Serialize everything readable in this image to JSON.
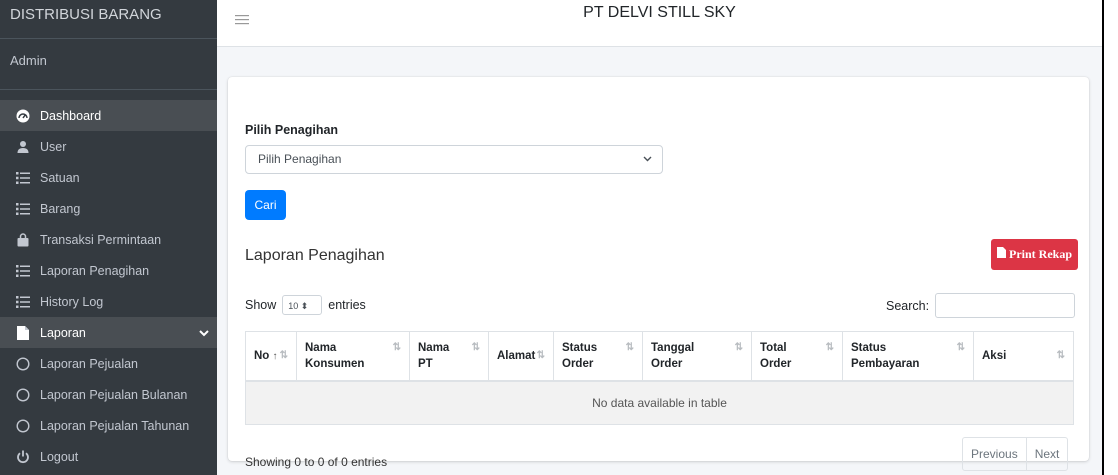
{
  "sidebar": {
    "brand": "DISTRIBUSI BARANG",
    "user": "Admin",
    "items": [
      {
        "label": "Dashboard",
        "icon": "dashboard-icon"
      },
      {
        "label": "User",
        "icon": "user-icon"
      },
      {
        "label": "Satuan",
        "icon": "list-icon"
      },
      {
        "label": "Barang",
        "icon": "list-icon"
      },
      {
        "label": "Transaksi Permintaan",
        "icon": "bag-icon"
      },
      {
        "label": "Laporan Penagihan",
        "icon": "list-icon"
      },
      {
        "label": "History Log",
        "icon": "list-icon"
      },
      {
        "label": "Laporan",
        "icon": "file-icon"
      },
      {
        "label": "Laporan Pejualan",
        "icon": "circle-icon"
      },
      {
        "label": "Laporan Pejualan Bulanan",
        "icon": "circle-icon"
      },
      {
        "label": "Laporan Pejualan Tahunan",
        "icon": "circle-icon"
      },
      {
        "label": "Logout",
        "icon": "power-icon"
      }
    ]
  },
  "topbar": {
    "title": "PT DELVI STILL SKY"
  },
  "form": {
    "label": "Pilih Penagihan",
    "select_value": "Pilih Penagihan",
    "button": "Cari"
  },
  "report": {
    "title": "Laporan Penagihan",
    "print_button": "Print Rekap",
    "show_label": "Show",
    "entries_value": "10",
    "entries_label": "entries",
    "search_label": "Search:"
  },
  "table": {
    "columns": [
      [
        "No"
      ],
      [
        "Nama",
        "Konsumen"
      ],
      [
        "Nama",
        "PT"
      ],
      [
        "Alamat"
      ],
      [
        "Status",
        "Order"
      ],
      [
        "Tanggal",
        "Order"
      ],
      [
        "Total",
        "Order"
      ],
      [
        "Status",
        "Pembayaran"
      ],
      [
        "Aksi"
      ]
    ],
    "empty_message": "No data available in table"
  },
  "footer": {
    "info": "Showing 0 to 0 of 0 entries",
    "previous": "Previous",
    "next": "Next"
  },
  "colors": {
    "sidebar": "#343a40",
    "primary": "#007bff",
    "danger": "#dc3545"
  }
}
